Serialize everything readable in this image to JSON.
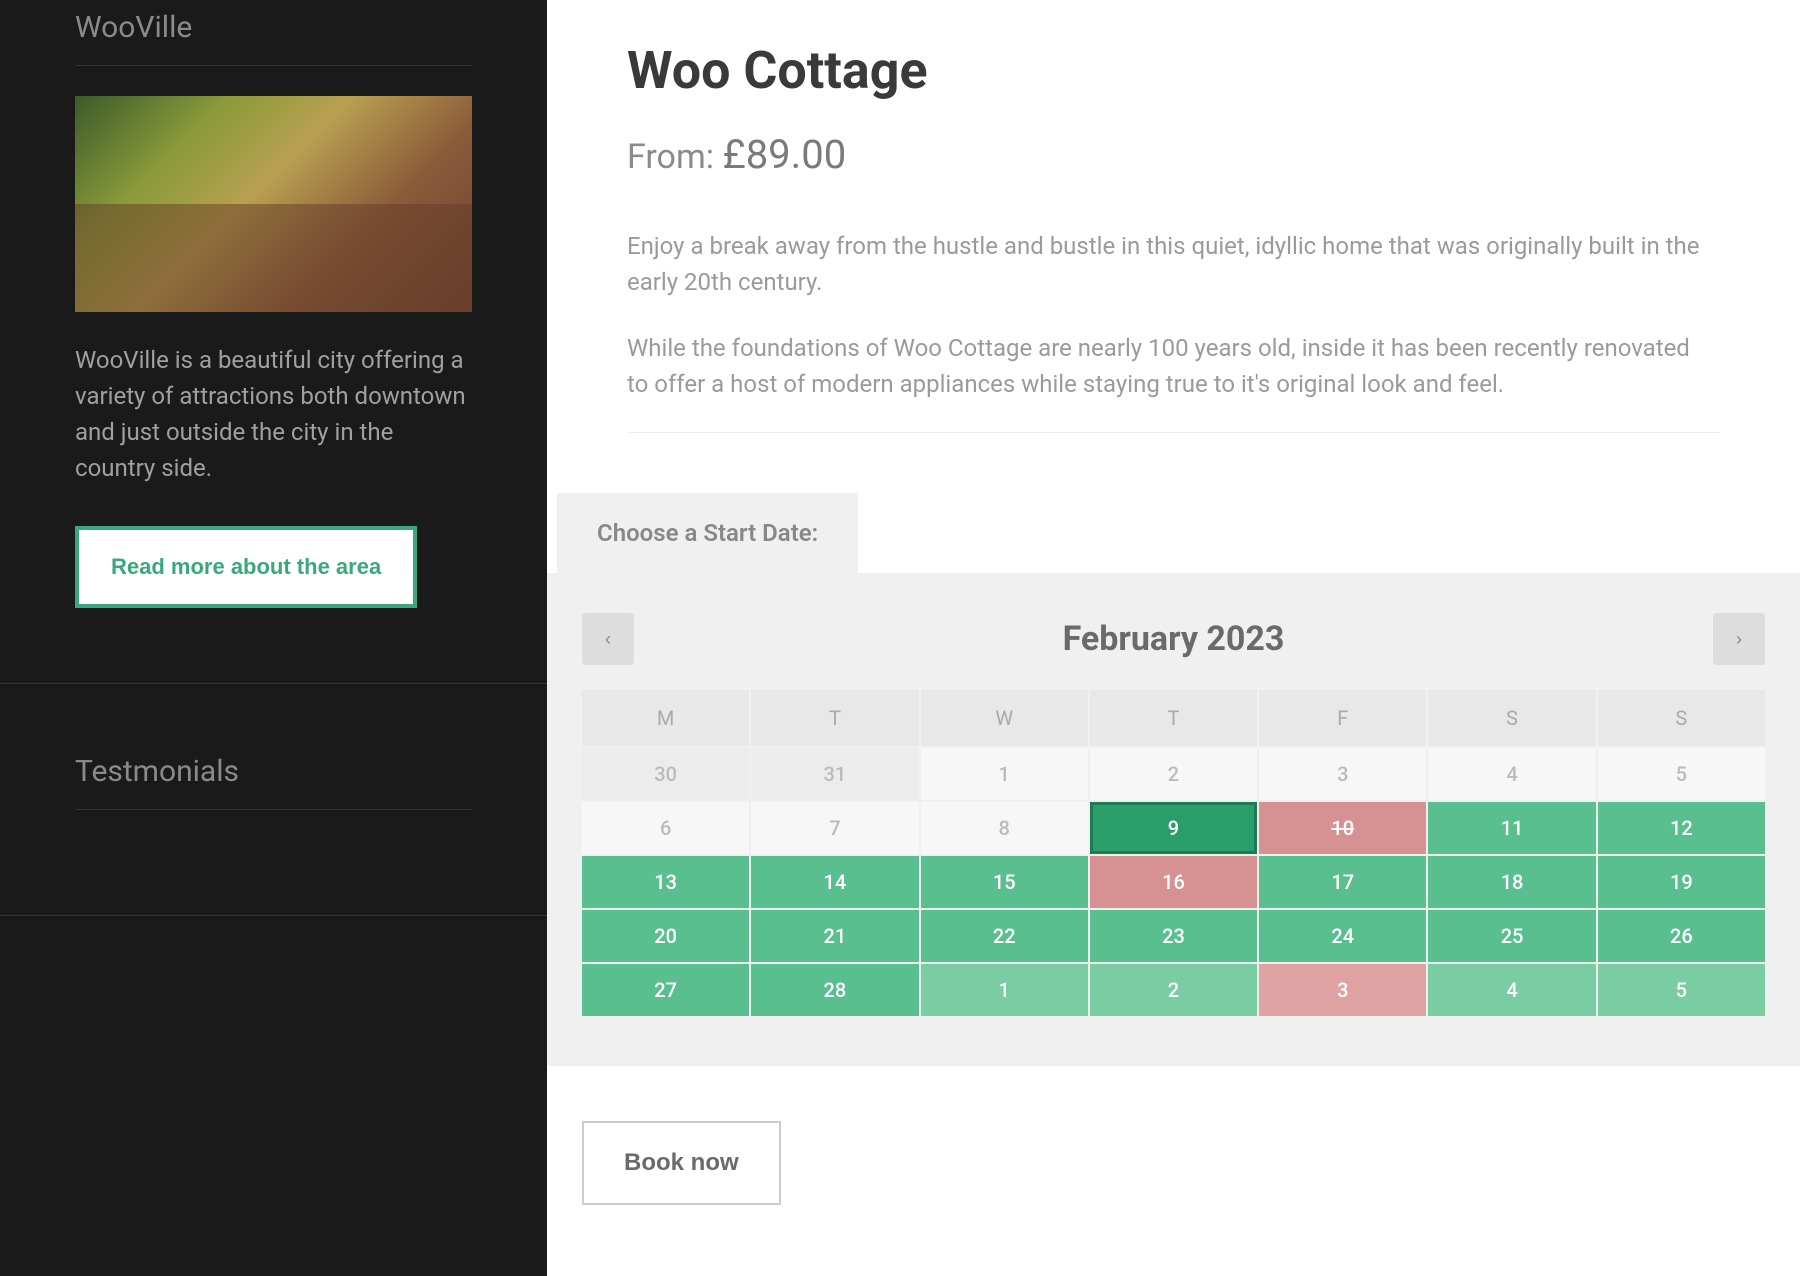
{
  "sidebar": {
    "area_title": "WooVille",
    "area_desc": "WooVille is a beautiful city offering a variety of attractions both downtown and just outside the city in the country side.",
    "read_more_label": "Read more about the area",
    "testimonials_title": "Testmonials"
  },
  "product": {
    "title": "Woo Cottage",
    "price_prefix": "From: ",
    "price": "£89.00",
    "desc1": "Enjoy a break away from the hustle and bustle in this quiet, idyllic home that was originally built in the early 20th century.",
    "desc2": "While the foundations of Woo Cottage are nearly 100 years old, inside it has been recently renovated to offer a host of modern appliances while staying true to it's original look and feel."
  },
  "booking": {
    "tab_label": "Choose a Start Date:",
    "month_title": "February 2023",
    "prev_glyph": "‹",
    "next_glyph": "›",
    "dow": [
      "M",
      "T",
      "W",
      "T",
      "F",
      "S",
      "S"
    ],
    "book_now_label": "Book now",
    "days": [
      {
        "n": "30",
        "cls": "prev-month",
        "int": false
      },
      {
        "n": "31",
        "cls": "prev-month",
        "int": false
      },
      {
        "n": "1",
        "cls": "disabled",
        "int": false
      },
      {
        "n": "2",
        "cls": "disabled",
        "int": false
      },
      {
        "n": "3",
        "cls": "disabled",
        "int": false
      },
      {
        "n": "4",
        "cls": "disabled",
        "int": false
      },
      {
        "n": "5",
        "cls": "disabled",
        "int": false
      },
      {
        "n": "6",
        "cls": "disabled",
        "int": false
      },
      {
        "n": "7",
        "cls": "disabled",
        "int": false
      },
      {
        "n": "8",
        "cls": "disabled",
        "int": false
      },
      {
        "n": "9",
        "cls": "selected",
        "int": true
      },
      {
        "n": "10",
        "cls": "unavailable strike",
        "int": false
      },
      {
        "n": "11",
        "cls": "available",
        "int": true
      },
      {
        "n": "12",
        "cls": "available",
        "int": true
      },
      {
        "n": "13",
        "cls": "available",
        "int": true
      },
      {
        "n": "14",
        "cls": "available",
        "int": true
      },
      {
        "n": "15",
        "cls": "available",
        "int": true
      },
      {
        "n": "16",
        "cls": "unavailable",
        "int": false
      },
      {
        "n": "17",
        "cls": "available",
        "int": true
      },
      {
        "n": "18",
        "cls": "available",
        "int": true
      },
      {
        "n": "19",
        "cls": "available",
        "int": true
      },
      {
        "n": "20",
        "cls": "available",
        "int": true
      },
      {
        "n": "21",
        "cls": "available",
        "int": true
      },
      {
        "n": "22",
        "cls": "available",
        "int": true
      },
      {
        "n": "23",
        "cls": "available",
        "int": true
      },
      {
        "n": "24",
        "cls": "available",
        "int": true
      },
      {
        "n": "25",
        "cls": "available",
        "int": true
      },
      {
        "n": "26",
        "cls": "available",
        "int": true
      },
      {
        "n": "27",
        "cls": "available",
        "int": true
      },
      {
        "n": "28",
        "cls": "available",
        "int": true
      },
      {
        "n": "1",
        "cls": "available-light",
        "int": true
      },
      {
        "n": "2",
        "cls": "available-light",
        "int": true
      },
      {
        "n": "3",
        "cls": "unavailable-light",
        "int": false
      },
      {
        "n": "4",
        "cls": "available-light",
        "int": true
      },
      {
        "n": "5",
        "cls": "available-light",
        "int": true
      }
    ]
  }
}
